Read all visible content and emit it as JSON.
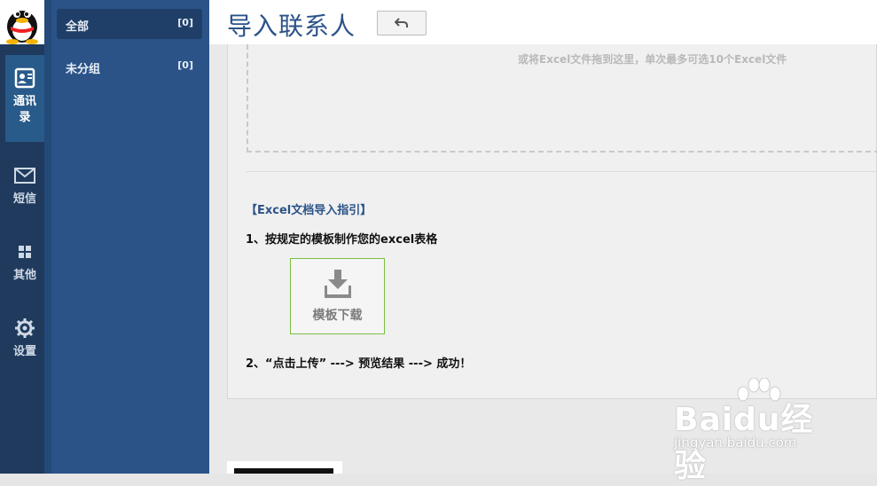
{
  "nav": {
    "items": [
      {
        "label": "通讯录",
        "icon": "contacts-icon",
        "active": true
      },
      {
        "label": "短信",
        "icon": "mail-icon",
        "active": false
      },
      {
        "label": "其他",
        "icon": "grid-icon",
        "active": false
      },
      {
        "label": "设置",
        "icon": "gear-icon",
        "active": false
      }
    ]
  },
  "groups": [
    {
      "name": "全部",
      "count": "[0]",
      "active": true
    },
    {
      "name": "未分组",
      "count": "[0]",
      "active": false
    }
  ],
  "header": {
    "title": "导入联系人",
    "back_icon": "undo-icon"
  },
  "upload": {
    "hint": "或将Excel文件拖到这里，单次最多可选10个Excel文件"
  },
  "guide": {
    "title": "【Excel文档导入指引】",
    "step1": "1、按规定的模板制作您的excel表格",
    "template_button": "模板下载",
    "step2": "2、“点击上传” ---> 预览结果 ---> 成功！"
  },
  "watermark": {
    "brand": "Baidu经验",
    "url": "jingyan.baidu.com"
  },
  "colors": {
    "rail": "#1f3a5c",
    "sidebar": "#2b5388",
    "accent": "#2b5388",
    "template_border": "#7bbf43"
  }
}
